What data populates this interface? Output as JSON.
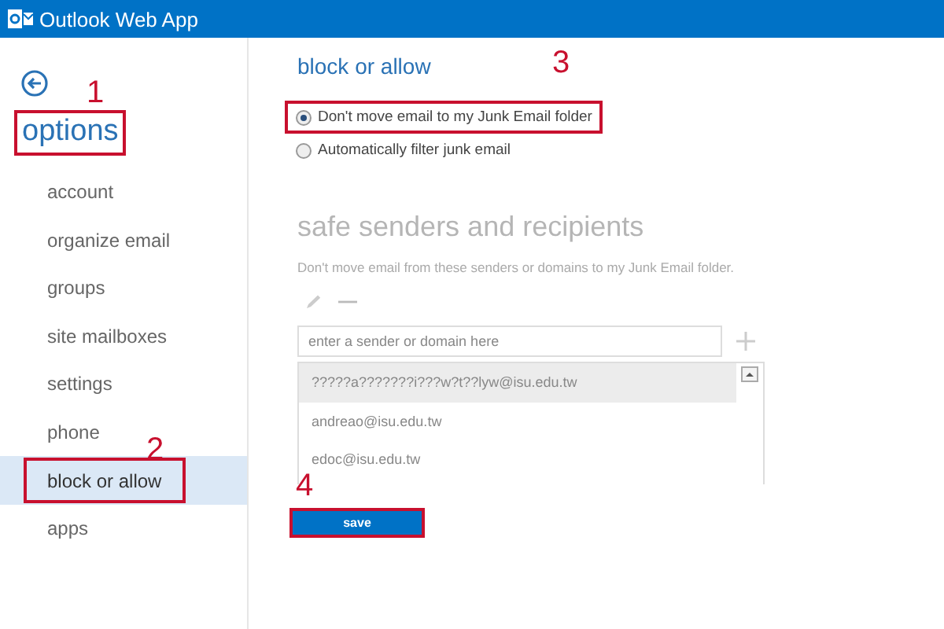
{
  "app_bar": {
    "title": "Outlook Web App"
  },
  "sidebar": {
    "heading": "options",
    "heading_annotation": "1",
    "items": [
      {
        "label": "account",
        "selected": false
      },
      {
        "label": "organize email",
        "selected": false
      },
      {
        "label": "groups",
        "selected": false
      },
      {
        "label": "site mailboxes",
        "selected": false
      },
      {
        "label": "settings",
        "selected": false
      },
      {
        "label": "phone",
        "selected": false
      },
      {
        "label": "block or allow",
        "selected": true,
        "annotation": "2"
      },
      {
        "label": "apps",
        "selected": false
      }
    ]
  },
  "main": {
    "title": "block or allow",
    "options": [
      {
        "label": "Don't move email to my Junk Email folder",
        "selected": true,
        "annotation": "3"
      },
      {
        "label": "Automatically filter junk email",
        "selected": false
      }
    ],
    "safe_senders": {
      "title": "safe senders and recipients",
      "description": "Don't move email from these senders or domains to my Junk Email folder.",
      "input": {
        "placeholder": "enter a sender or domain here"
      },
      "entries": [
        {
          "text": "?????a???????i???w?t??lyw@isu.edu.tw",
          "selected": true
        },
        {
          "text": "andreao@isu.edu.tw",
          "selected": false
        },
        {
          "text": "edoc@isu.edu.tw",
          "selected": false
        }
      ]
    },
    "save_button": {
      "label": "save",
      "annotation": "4"
    }
  }
}
